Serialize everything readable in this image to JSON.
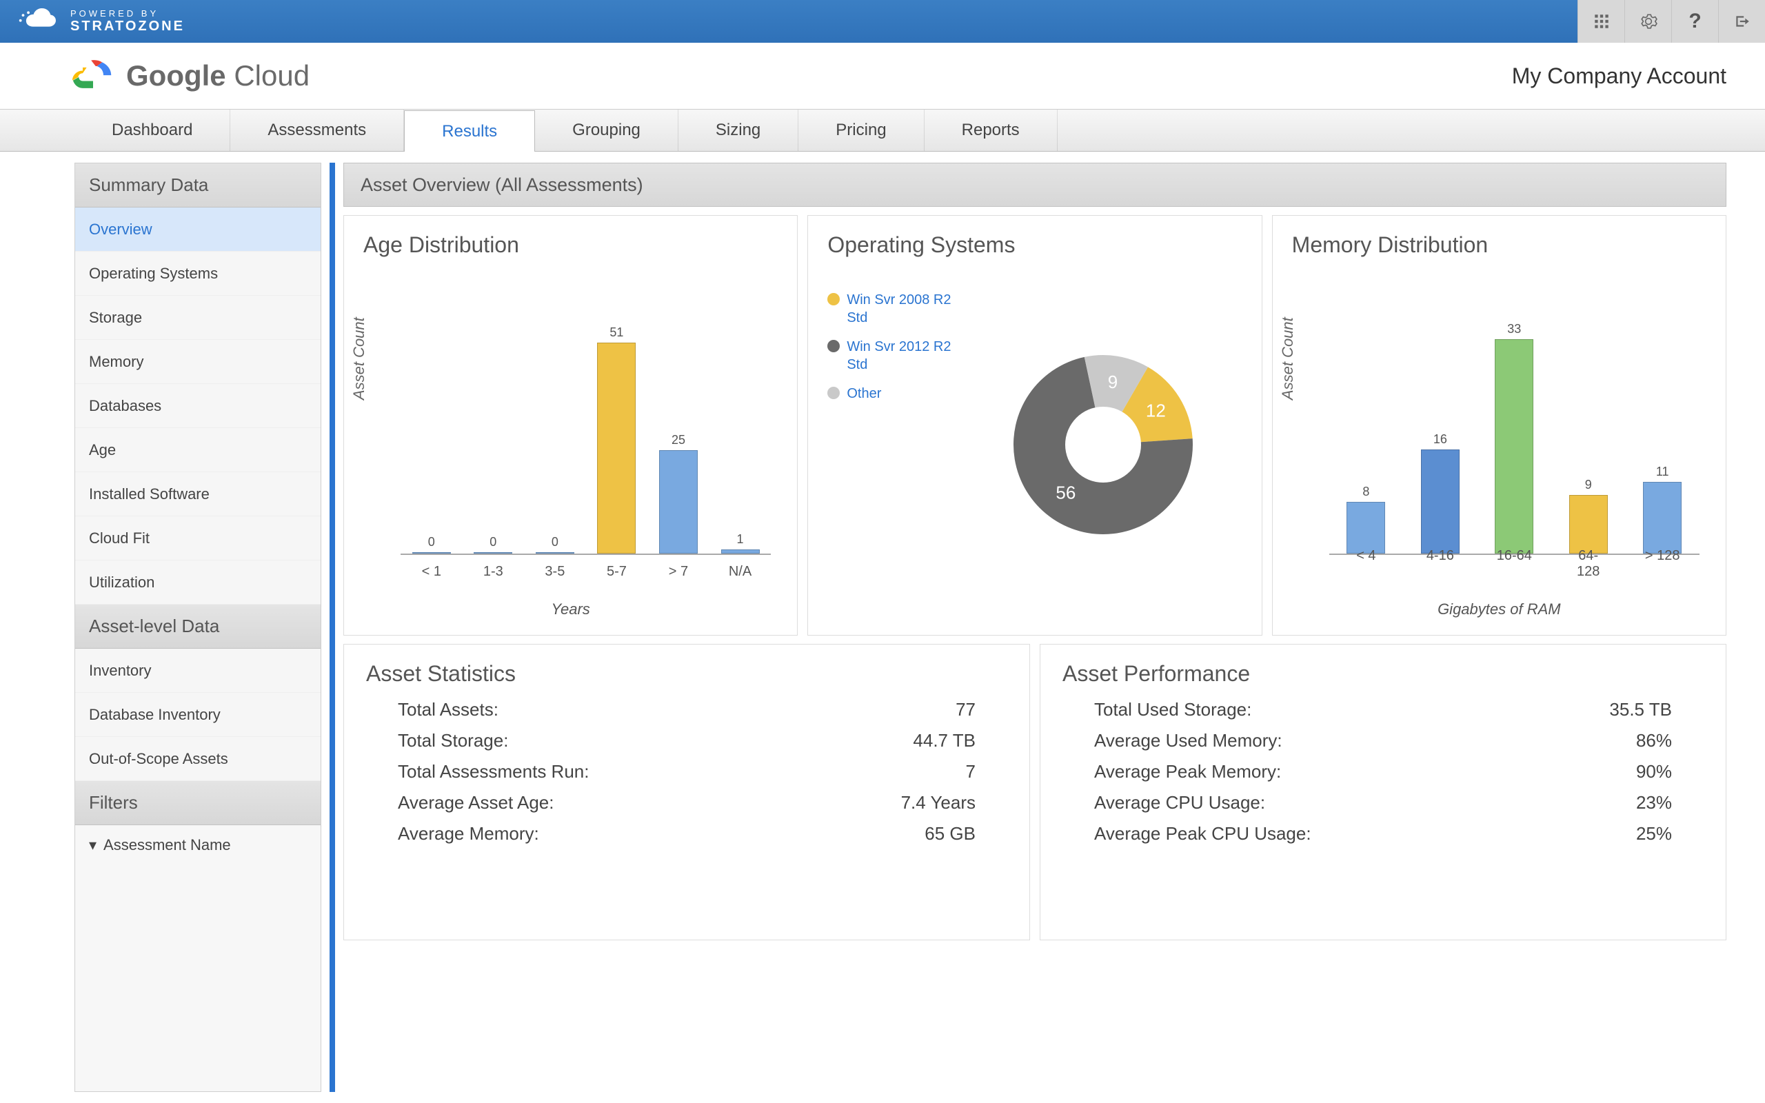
{
  "header": {
    "powered_line1": "POWERED BY",
    "powered_line2": "STRATOZONE"
  },
  "brand": {
    "google": "Google ",
    "cloud": "Cloud",
    "account": "My Company Account"
  },
  "nav": {
    "items": [
      "Dashboard",
      "Assessments",
      "Results",
      "Grouping",
      "Sizing",
      "Pricing",
      "Reports"
    ],
    "active": 2
  },
  "sidebar": {
    "sections": [
      {
        "title": "Summary Data",
        "items": [
          "Overview",
          "Operating Systems",
          "Storage",
          "Memory",
          "Databases",
          "Age",
          "Installed Software",
          "Cloud Fit",
          "Utilization"
        ],
        "active": 0
      },
      {
        "title": "Asset-level Data",
        "items": [
          "Inventory",
          "Database Inventory",
          "Out-of-Scope Assets"
        ]
      },
      {
        "title": "Filters",
        "filter": "Assessment Name"
      }
    ]
  },
  "content_title": "Asset Overview (All Assessments)",
  "age": {
    "title": "Age Distribution",
    "ylabel": "Asset Count",
    "xlabel": "Years"
  },
  "os": {
    "title": "Operating Systems"
  },
  "mem": {
    "title": "Memory Distribution",
    "ylabel": "Asset Count",
    "xlabel": "Gigabytes of RAM"
  },
  "stats": {
    "title": "Asset Statistics",
    "rows": [
      {
        "l": "Total Assets:",
        "v": "77"
      },
      {
        "l": "Total Storage:",
        "v": "44.7 TB"
      },
      {
        "l": "Total Assessments Run:",
        "v": "7"
      },
      {
        "l": "Average Asset Age:",
        "v": "7.4 Years"
      },
      {
        "l": "Average Memory:",
        "v": "65 GB"
      }
    ]
  },
  "perf": {
    "title": "Asset Performance",
    "rows": [
      {
        "l": "Total Used Storage:",
        "v": "35.5 TB"
      },
      {
        "l": "Average Used Memory:",
        "v": "86%"
      },
      {
        "l": "Average Peak Memory:",
        "v": "90%"
      },
      {
        "l": "Average CPU Usage:",
        "v": "23%"
      },
      {
        "l": "Average Peak CPU Usage:",
        "v": "25%"
      }
    ]
  },
  "chart_data": [
    {
      "type": "bar",
      "title": "Age Distribution",
      "ylabel": "Asset Count",
      "xlabel": "Years",
      "categories": [
        "< 1",
        "1-3",
        "3-5",
        "5-7",
        "> 7",
        "N/A"
      ],
      "values": [
        0,
        0,
        0,
        51,
        25,
        1
      ],
      "colors": [
        "#79a9e0",
        "#79a9e0",
        "#79a9e0",
        "#eec245",
        "#79a9e0",
        "#79a9e0"
      ],
      "ylim": [
        0,
        55
      ]
    },
    {
      "type": "pie",
      "title": "Operating Systems",
      "series": [
        {
          "name": "Win Svr 2008 R2 Std",
          "value": 12,
          "color": "#eec245"
        },
        {
          "name": "Win Svr 2012 R2 Std",
          "value": 56,
          "color": "#6a6a6a"
        },
        {
          "name": "Other",
          "value": 9,
          "color": "#c9c9c9"
        }
      ]
    },
    {
      "type": "bar",
      "title": "Memory Distribution",
      "ylabel": "Asset Count",
      "xlabel": "Gigabytes of RAM",
      "categories": [
        "< 4",
        "4-16",
        "16-64",
        "64-128",
        "> 128"
      ],
      "values": [
        8,
        16,
        33,
        9,
        11
      ],
      "colors": [
        "#79a9e0",
        "#5b8ed1",
        "#8cc976",
        "#eec245",
        "#79a9e0"
      ],
      "ylim": [
        0,
        35
      ]
    }
  ]
}
